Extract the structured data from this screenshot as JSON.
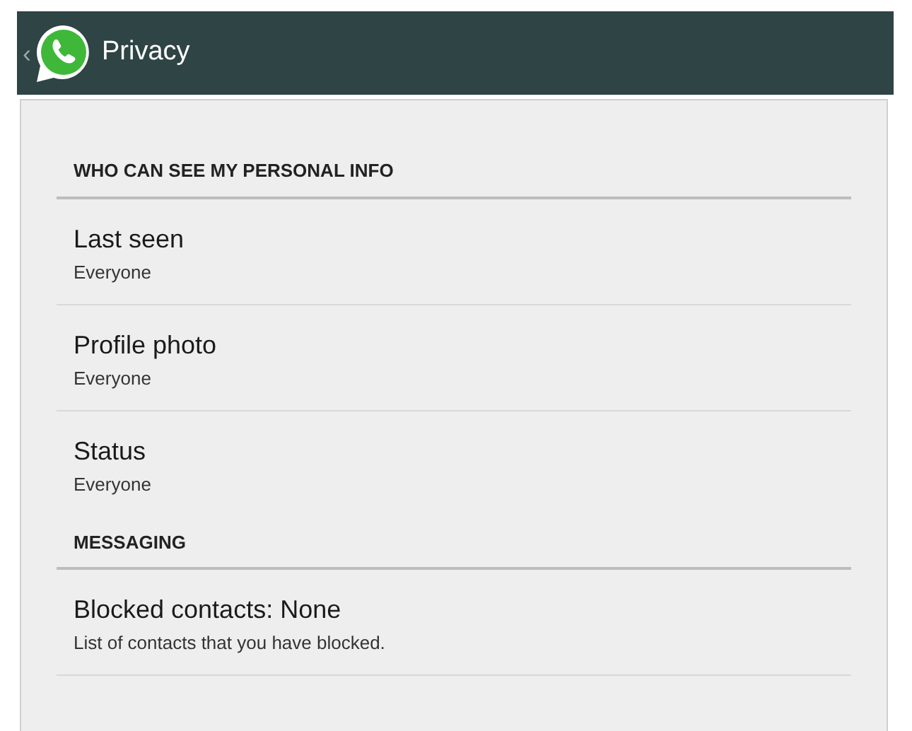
{
  "header": {
    "back": "‹",
    "title": "Privacy"
  },
  "sections": [
    {
      "heading": "WHO CAN SEE MY PERSONAL INFO",
      "items": [
        {
          "title": "Last seen",
          "subtitle": "Everyone"
        },
        {
          "title": "Profile photo",
          "subtitle": "Everyone"
        },
        {
          "title": "Status",
          "subtitle": "Everyone"
        }
      ]
    },
    {
      "heading": "MESSAGING",
      "items": [
        {
          "title": "Blocked contacts: None",
          "subtitle": "List of contacts that you have blocked."
        }
      ]
    }
  ]
}
